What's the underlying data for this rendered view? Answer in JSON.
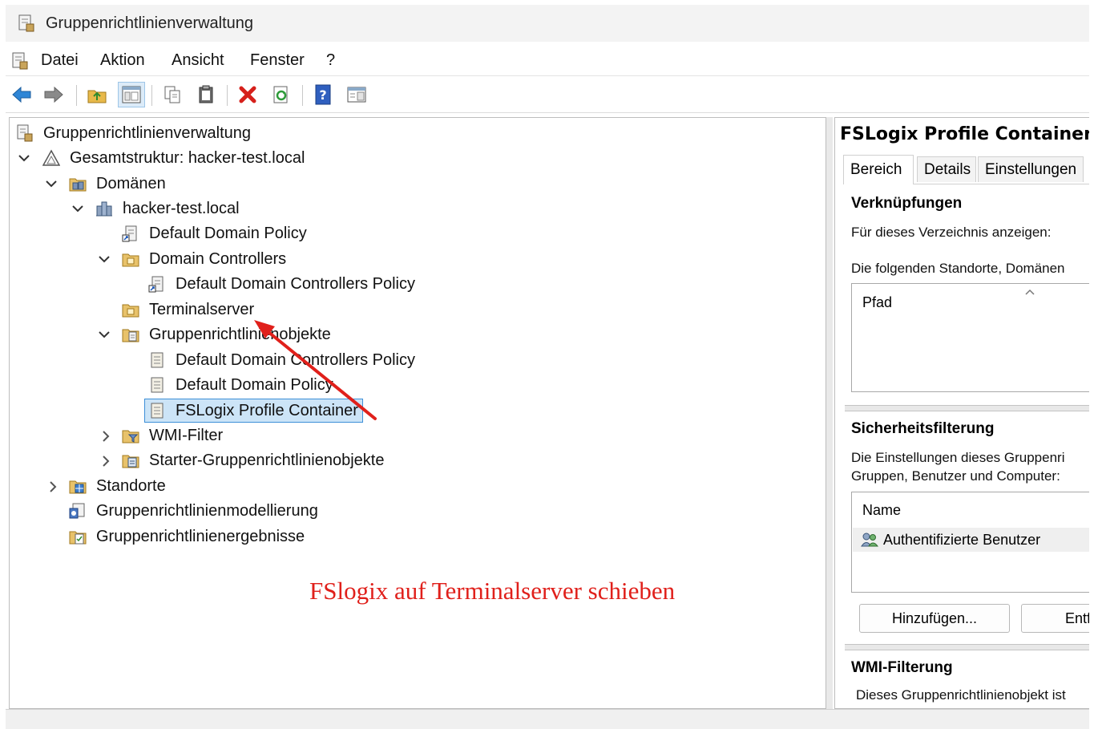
{
  "window": {
    "title": "Gruppenrichtlinienverwaltung"
  },
  "menu": {
    "items": [
      "Datei",
      "Aktion",
      "Ansicht",
      "Fenster",
      "?"
    ]
  },
  "toolbar": {
    "icons": [
      "back-arrow-icon",
      "forward-arrow-icon",
      "up-folder-icon",
      "show-hide-tree-icon",
      "copy-icon",
      "paste-icon",
      "delete-icon",
      "refresh-icon",
      "help-icon",
      "properties-icon"
    ]
  },
  "tree": {
    "root": "Gruppenrichtlinienverwaltung",
    "forest": "Gesamtstruktur: hacker-test.local",
    "domains": "Domänen",
    "domain": "hacker-test.local",
    "default_domain_policy_link": "Default Domain Policy",
    "domain_controllers": "Domain Controllers",
    "ddc_policy_link": "Default Domain Controllers Policy",
    "terminalserver": "Terminalserver",
    "gpo_container": "Gruppenrichtlinienobjekte",
    "gpo_ddc_policy": "Default Domain Controllers Policy",
    "gpo_default_domain_policy": "Default Domain Policy",
    "gpo_fslogix": "FSLogix Profile Container",
    "wmi_filter": "WMI-Filter",
    "starter_gpos": "Starter-Gruppenrichtlinienobjekte",
    "sites": "Standorte",
    "modeling": "Gruppenrichtlinienmodellierung",
    "results": "Gruppenrichtlinienergebnisse"
  },
  "annotation": {
    "text": "FSlogix auf Terminalserver schieben",
    "color": "#e0201b"
  },
  "details": {
    "title": "FSLogix Profile Container",
    "tabs": [
      "Bereich",
      "Details",
      "Einstellungen"
    ],
    "links_heading": "Verknüpfungen",
    "links_show_for": "Für dieses Verzeichnis anzeigen:",
    "links_desc": "Die folgenden Standorte, Domänen",
    "links_col_path": "Pfad",
    "security_heading": "Sicherheitsfilterung",
    "security_desc_1": "Die Einstellungen dieses Gruppenri",
    "security_desc_2": "Gruppen, Benutzer und Computer:",
    "security_col_name": "Name",
    "security_entry": "Authentifizierte Benutzer",
    "btn_add": "Hinzufügen...",
    "btn_remove": "Entf",
    "wmi_heading": "WMI-Filterung",
    "wmi_desc": "Dieses Gruppenrichtlinienobjekt ist"
  }
}
